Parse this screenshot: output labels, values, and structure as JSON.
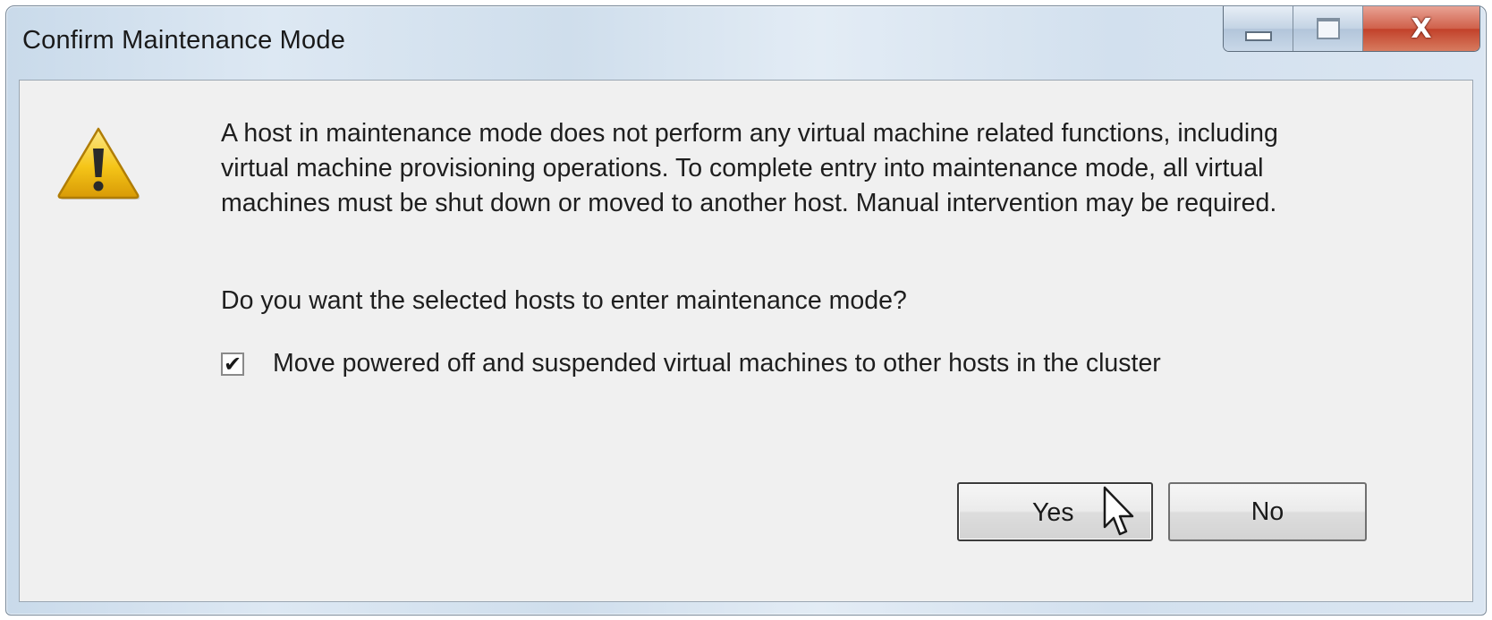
{
  "window": {
    "title": "Confirm Maintenance Mode",
    "controls": {
      "minimize": "minimize-icon",
      "maximize": "maximize-icon",
      "close": "X"
    }
  },
  "dialog": {
    "icon": "warning-icon",
    "message": "A host in maintenance mode does not perform any virtual machine related functions, including virtual machine provisioning operations. To complete entry into maintenance mode, all virtual machines must be shut down or moved to another host. Manual intervention may be required.",
    "question": "Do you want the selected hosts to enter maintenance mode?",
    "checkbox": {
      "label": "Move powered off and suspended virtual machines to other hosts in the cluster",
      "checked": true,
      "mark": "✔"
    },
    "buttons": {
      "yes": "Yes",
      "no": "No"
    }
  },
  "colors": {
    "warning_fill": "#f5c518",
    "close_button": "#c7462e",
    "dialog_background": "#f0f0f0"
  }
}
